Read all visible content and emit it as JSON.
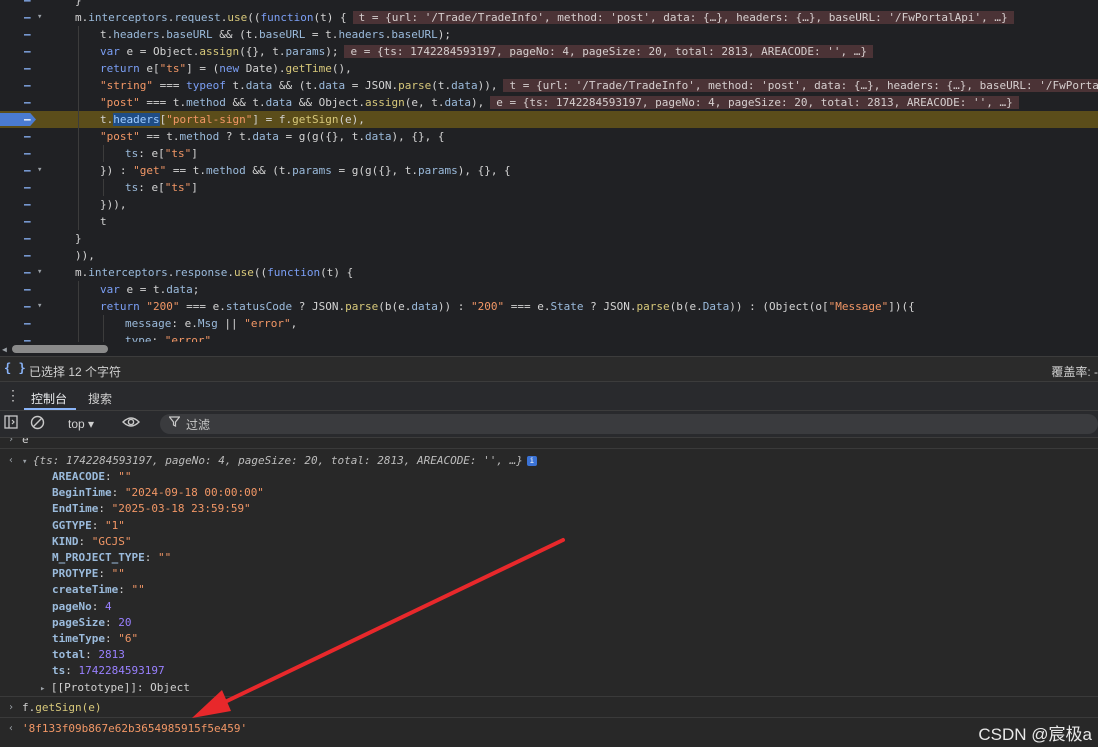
{
  "source": {
    "lines": [
      {
        "marker": "–",
        "fold": "",
        "indent": 1,
        "html": "<span class=\"plain\">}</span>"
      },
      {
        "marker": "–",
        "fold": "▾",
        "indent": 1,
        "html": "<span class=\"plain\">m.</span><span class=\"prop\">interceptors</span><span class=\"plain\">.</span><span class=\"prop\">request</span><span class=\"plain\">.</span><span class=\"fn\">use</span><span class=\"plain\">((</span><span class=\"kw\">function</span><span class=\"plain\">(t) {</span><span class=\"inline-val\">t = {url: '/Trade/TradeInfo', method: 'post', data: {…}, headers: {…}, baseURL: '/FwPortalApi', …}</span>"
      },
      {
        "marker": "–",
        "fold": "",
        "indent": 2,
        "html": "<span class=\"plain\">t.</span><span class=\"prop\">headers</span><span class=\"plain\">.</span><span class=\"prop\">baseURL</span><span class=\"plain\"> &amp;&amp; (t.</span><span class=\"prop\">baseURL</span><span class=\"plain\"> = t.</span><span class=\"prop\">headers</span><span class=\"plain\">.</span><span class=\"prop\">baseURL</span><span class=\"plain\">);</span>"
      },
      {
        "marker": "–",
        "fold": "",
        "indent": 2,
        "html": "<span class=\"kw\">var</span><span class=\"plain\"> e = Object.</span><span class=\"fn\">assign</span><span class=\"plain\">({}, t.</span><span class=\"prop\">params</span><span class=\"plain\">);</span><span class=\"inline-val\">e = {ts: 1742284593197, pageNo: 4, pageSize: 20, total: 2813, AREACODE: '', …}</span>"
      },
      {
        "marker": "–",
        "fold": "",
        "indent": 2,
        "html": "<span class=\"kw\">return</span><span class=\"plain\"> e[</span><span class=\"str\">\"ts\"</span><span class=\"plain\">] = (</span><span class=\"kw\">new</span><span class=\"plain\"> Date).</span><span class=\"fn\">getTime</span><span class=\"plain\">(),</span>"
      },
      {
        "marker": "–",
        "fold": "",
        "indent": 2,
        "html": "<span class=\"str\">\"string\"</span><span class=\"plain\"> === </span><span class=\"kw\">typeof</span><span class=\"plain\"> t.</span><span class=\"prop\">data</span><span class=\"plain\"> &amp;&amp; (t.</span><span class=\"prop\">data</span><span class=\"plain\"> = JSON.</span><span class=\"fn\">parse</span><span class=\"plain\">(t.</span><span class=\"prop\">data</span><span class=\"plain\">)),</span><span class=\"inline-val\">t = {url: '/Trade/TradeInfo', method: 'post', data: {…}, headers: {…}, baseURL: '/FwPortalApi', …}</span>"
      },
      {
        "marker": "–",
        "fold": "",
        "indent": 2,
        "html": "<span class=\"str\">\"post\"</span><span class=\"plain\"> === t.</span><span class=\"prop\">method</span><span class=\"plain\"> &amp;&amp; t.</span><span class=\"prop\">data</span><span class=\"plain\"> &amp;&amp; Object.</span><span class=\"fn\">assign</span><span class=\"plain\">(e, t.</span><span class=\"prop\">data</span><span class=\"plain\">),</span><span class=\"inline-val\">e = {ts: 1742284593197, pageNo: 4, pageSize: 20, total: 2813, AREACODE: '', …}</span>"
      },
      {
        "marker": "–",
        "fold": "",
        "indent": 2,
        "paused": true,
        "bp": true,
        "html": "<span class=\"plain\">t.</span><span class=\"hl\">headers</span><span class=\"plain\">[</span><span class=\"str\">\"portal-sign\"</span><span class=\"plain\">] = f.</span><span class=\"fn\">getSign</span><span class=\"plain\">(e),</span>"
      },
      {
        "marker": "–",
        "fold": "",
        "indent": 2,
        "html": "<span class=\"str\">\"post\"</span><span class=\"plain\"> == t.</span><span class=\"prop\">method</span><span class=\"plain\"> ? t.</span><span class=\"prop\">data</span><span class=\"plain\"> = g(g({}, t.</span><span class=\"prop\">data</span><span class=\"plain\">), {}, {</span>"
      },
      {
        "marker": "–",
        "fold": "",
        "indent": 3,
        "html": "<span class=\"prop\">ts</span><span class=\"plain\">: e[</span><span class=\"str\">\"ts\"</span><span class=\"plain\">]</span>"
      },
      {
        "marker": "–",
        "fold": "▾",
        "indent": 2,
        "html": "<span class=\"plain\">}) : </span><span class=\"str\">\"get\"</span><span class=\"plain\"> == t.</span><span class=\"prop\">method</span><span class=\"plain\"> &amp;&amp; (t.</span><span class=\"prop\">params</span><span class=\"plain\"> = g(g({}, t.</span><span class=\"prop\">params</span><span class=\"plain\">), {}, {</span>"
      },
      {
        "marker": "–",
        "fold": "",
        "indent": 3,
        "html": "<span class=\"prop\">ts</span><span class=\"plain\">: e[</span><span class=\"str\">\"ts\"</span><span class=\"plain\">]</span>"
      },
      {
        "marker": "–",
        "fold": "",
        "indent": 2,
        "html": "<span class=\"plain\">})),</span>"
      },
      {
        "marker": "–",
        "fold": "",
        "indent": 2,
        "html": "<span class=\"plain\">t</span>"
      },
      {
        "marker": "–",
        "fold": "",
        "indent": 1,
        "html": "<span class=\"plain\">}</span>"
      },
      {
        "marker": "–",
        "fold": "",
        "indent": 1,
        "html": "<span class=\"plain\">)),</span>"
      },
      {
        "marker": "–",
        "fold": "▾",
        "indent": 1,
        "html": "<span class=\"plain\">m.</span><span class=\"prop\">interceptors</span><span class=\"plain\">.</span><span class=\"prop\">response</span><span class=\"plain\">.</span><span class=\"fn\">use</span><span class=\"plain\">((</span><span class=\"kw\">function</span><span class=\"plain\">(t) {</span>"
      },
      {
        "marker": "–",
        "fold": "",
        "indent": 2,
        "html": "<span class=\"kw\">var</span><span class=\"plain\"> e = t.</span><span class=\"prop\">data</span><span class=\"plain\">;</span>"
      },
      {
        "marker": "–",
        "fold": "▾",
        "indent": 2,
        "html": "<span class=\"kw\">return</span><span class=\"plain\"> </span><span class=\"str\">\"200\"</span><span class=\"plain\"> === e.</span><span class=\"prop\">statusCode</span><span class=\"plain\"> ? JSON.</span><span class=\"fn\">parse</span><span class=\"plain\">(b(e.</span><span class=\"prop\">data</span><span class=\"plain\">)) : </span><span class=\"str\">\"200\"</span><span class=\"plain\"> === e.</span><span class=\"prop\">State</span><span class=\"plain\"> ? JSON.</span><span class=\"fn\">parse</span><span class=\"plain\">(b(e.</span><span class=\"prop\">Data</span><span class=\"plain\">)) : (Object(o[</span><span class=\"str\">\"Message\"</span><span class=\"plain\">])({</span>"
      },
      {
        "marker": "–",
        "fold": "",
        "indent": 3,
        "html": "<span class=\"prop\">message</span><span class=\"plain\">: e.</span><span class=\"prop\">Msg</span><span class=\"plain\"> || </span><span class=\"str\">\"error\"</span><span class=\"plain\">,</span>"
      },
      {
        "marker": "–",
        "fold": "",
        "indent": 3,
        "html": "<span class=\"prop\">type</span><span class=\"plain\">: </span><span class=\"str\">\"error\"</span><span class=\"plain\">,</span>"
      }
    ]
  },
  "statusbar": {
    "braces": "{ }",
    "selection": "已选择 12 个字符",
    "coverage": "覆盖率: -"
  },
  "drawer": {
    "menu_icon": "⋮",
    "tabs": [
      "控制台",
      "搜索"
    ]
  },
  "toolbar": {
    "context": "top ▾",
    "filter_placeholder": "过滤"
  },
  "console": {
    "cut_line": "e",
    "object_preview": "{ts: 1742284593197, pageNo: 4, pageSize: 20, total: 2813, AREACODE: '', …}",
    "props": [
      {
        "key": "AREACODE",
        "value": "\"\"",
        "type": "str"
      },
      {
        "key": "BeginTime",
        "value": "\"2024-09-18 00:00:00\"",
        "type": "str"
      },
      {
        "key": "EndTime",
        "value": "\"2025-03-18 23:59:59\"",
        "type": "str"
      },
      {
        "key": "GGTYPE",
        "value": "\"1\"",
        "type": "str"
      },
      {
        "key": "KIND",
        "value": "\"GCJS\"",
        "type": "str"
      },
      {
        "key": "M_PROJECT_TYPE",
        "value": "\"\"",
        "type": "str"
      },
      {
        "key": "PROTYPE",
        "value": "\"\"",
        "type": "str"
      },
      {
        "key": "createTime",
        "value": "\"\"",
        "type": "str"
      },
      {
        "key": "pageNo",
        "value": "4",
        "type": "num"
      },
      {
        "key": "pageSize",
        "value": "20",
        "type": "num"
      },
      {
        "key": "timeType",
        "value": "\"6\"",
        "type": "str"
      },
      {
        "key": "total",
        "value": "2813",
        "type": "num"
      },
      {
        "key": "ts",
        "value": "1742284593197",
        "type": "num"
      }
    ],
    "prototype": "[[Prototype]]: Object",
    "input_expr": "f.getSign(e)",
    "result": "'8f133f09b867e62b3654985915f5e459'"
  },
  "watermark": "CSDN @宸极a",
  "colors": {
    "arrow": "#e8282b",
    "paused_line": "#5b4d1a",
    "accent": "#8ab4f8"
  }
}
